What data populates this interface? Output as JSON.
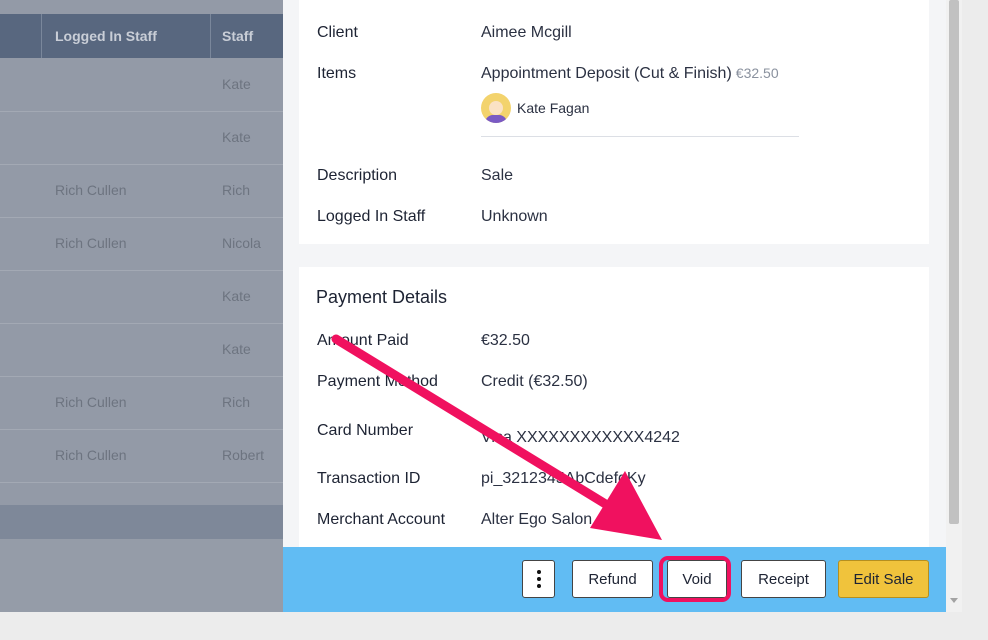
{
  "table": {
    "columns": [
      "Logged In Staff",
      "Staff"
    ],
    "rows": [
      {
        "logged_in_staff": "",
        "staff": "Kate"
      },
      {
        "logged_in_staff": "",
        "staff": "Kate"
      },
      {
        "logged_in_staff": "Rich Cullen",
        "staff": "Rich"
      },
      {
        "logged_in_staff": "Rich Cullen",
        "staff": "Nicola"
      },
      {
        "logged_in_staff": "",
        "staff": "Kate"
      },
      {
        "logged_in_staff": "",
        "staff": "Kate"
      },
      {
        "logged_in_staff": "Rich Cullen",
        "staff": "Rich"
      },
      {
        "logged_in_staff": "Rich Cullen",
        "staff": "Robert"
      }
    ]
  },
  "sale_details": {
    "client_label": "Client",
    "client_value": "Aimee Mcgill",
    "items_label": "Items",
    "item_name": "Appointment Deposit (Cut & Finish)",
    "item_price": "€32.50",
    "item_staff": "Kate Fagan",
    "description_label": "Description",
    "description_value": "Sale",
    "logged_in_staff_label": "Logged In Staff",
    "logged_in_staff_value": "Unknown"
  },
  "payment_details": {
    "title": "Payment Details",
    "amount_paid_label": "Amount Paid",
    "amount_paid_value": "€32.50",
    "payment_method_label": "Payment Method",
    "payment_method_value": "Credit (€32.50)",
    "card_number_label": "Card Number",
    "card_number_value": "Visa XXXXXXXXXXXX4242",
    "transaction_id_label": "Transaction ID",
    "transaction_id_value": "pi_3212345AbCdefgKy",
    "merchant_account_label": "Merchant Account",
    "merchant_account_value": "Alter Ego Salon"
  },
  "actions": {
    "more_icon": "kebab-icon",
    "refund_label": "Refund",
    "void_label": "Void",
    "receipt_label": "Receipt",
    "edit_sale_label": "Edit Sale"
  },
  "colors": {
    "action_bar": "#61bcf3",
    "highlight": "#f0115f",
    "edit_button": "#f0c33c"
  }
}
